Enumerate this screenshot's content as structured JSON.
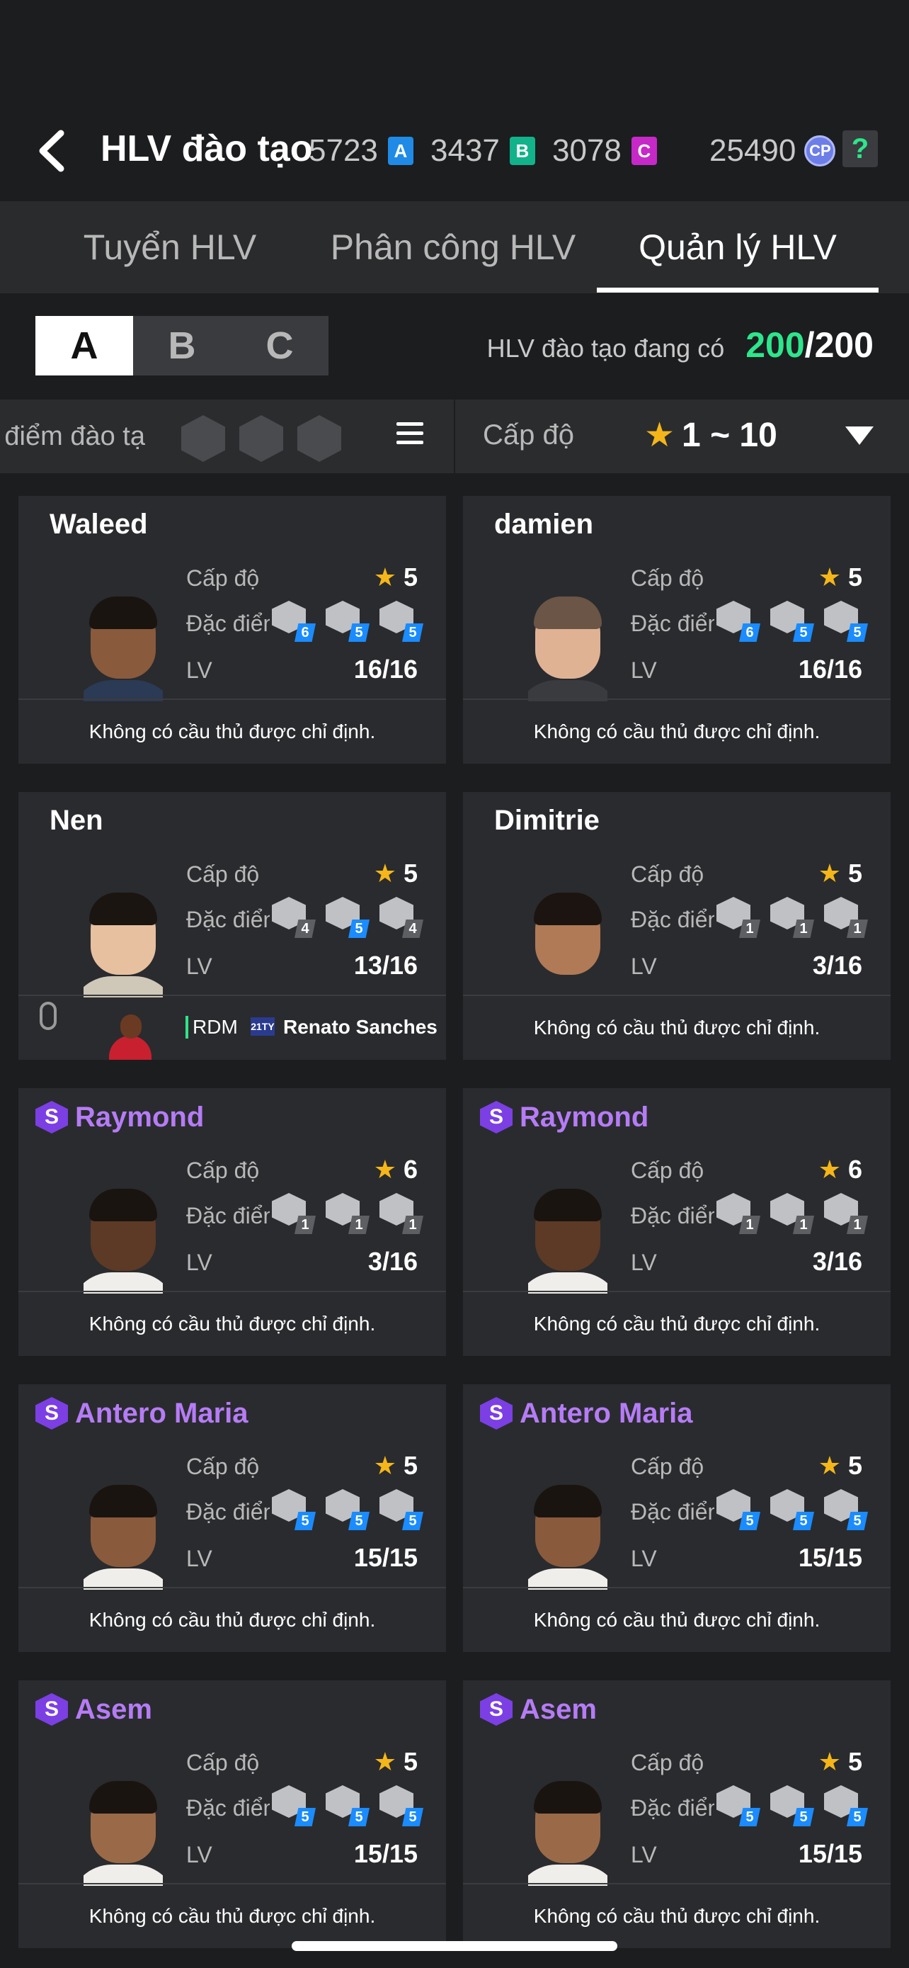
{
  "header": {
    "title": "HLV đào tạo",
    "currencies": [
      {
        "amount": "5723",
        "badge": "A",
        "color": "#1f8be6"
      },
      {
        "amount": "3437",
        "badge": "B",
        "color": "#12b38a"
      },
      {
        "amount": "3078",
        "badge": "C",
        "color": "#c629c8"
      }
    ],
    "cp_amount": "25490",
    "cp_label": "CP",
    "help_label": "?"
  },
  "tabs": [
    {
      "label": "Tuyển HLV",
      "active": false
    },
    {
      "label": "Phân công HLV",
      "active": false
    },
    {
      "label": "Quản lý HLV",
      "active": true
    }
  ],
  "groups": [
    {
      "label": "A",
      "active": true
    },
    {
      "label": "B",
      "active": false
    },
    {
      "label": "C",
      "active": false
    }
  ],
  "capacity": {
    "label": "HLV đào tạo đang có",
    "current": "200",
    "separator": "/",
    "max": "200"
  },
  "filter": {
    "trait_filter_label": "điểm đào tạ",
    "level_label": "Cấp độ",
    "level_range": "1 ~ 10"
  },
  "labels": {
    "level": "Cấp độ",
    "trait": "Đặc điểm",
    "lv": "LV",
    "no_player": "Không có cầu thủ được chỉ định."
  },
  "coaches": [
    {
      "name": "Waleed",
      "special": false,
      "stars": "5",
      "traits": [
        {
          "n": "6",
          "c": "blue"
        },
        {
          "n": "5",
          "c": "blue"
        },
        {
          "n": "5",
          "c": "blue"
        }
      ],
      "lv": "16/16",
      "skin": "#8a5a3c",
      "hair": "#1a1410",
      "shirt": "#2b3a55",
      "assigned": null
    },
    {
      "name": "damien",
      "special": false,
      "stars": "5",
      "traits": [
        {
          "n": "6",
          "c": "blue"
        },
        {
          "n": "5",
          "c": "blue"
        },
        {
          "n": "5",
          "c": "blue"
        }
      ],
      "lv": "16/16",
      "skin": "#e0b294",
      "hair": "#6b5546",
      "shirt": "#3a3b3f",
      "assigned": null
    },
    {
      "name": "Nen",
      "special": false,
      "stars": "5",
      "traits": [
        {
          "n": "4",
          "c": "grey"
        },
        {
          "n": "5",
          "c": "blue"
        },
        {
          "n": "4",
          "c": "grey"
        }
      ],
      "lv": "13/16",
      "skin": "#e7c0a0",
      "hair": "#1b1512",
      "shirt": "#cfc7b8",
      "assigned": {
        "position": "RDM",
        "season": "21TY",
        "player": "Renato Sanches"
      }
    },
    {
      "name": "Dimitrie",
      "special": false,
      "stars": "5",
      "traits": [
        {
          "n": "1",
          "c": "grey"
        },
        {
          "n": "1",
          "c": "grey"
        },
        {
          "n": "1",
          "c": "grey"
        }
      ],
      "lv": "3/16",
      "skin": "#b07a56",
      "hair": "#1b1410",
      "shirt": "#2a2b2e",
      "assigned": null
    },
    {
      "name": "Raymond",
      "special": true,
      "special_badge": "S",
      "stars": "6",
      "traits": [
        {
          "n": "1",
          "c": "grey"
        },
        {
          "n": "1",
          "c": "grey"
        },
        {
          "n": "1",
          "c": "grey"
        }
      ],
      "lv": "3/16",
      "skin": "#5c3a26",
      "hair": "#1a1410",
      "shirt": "#f0eeea",
      "assigned": null
    },
    {
      "name": "Raymond",
      "special": true,
      "special_badge": "S",
      "stars": "6",
      "traits": [
        {
          "n": "1",
          "c": "grey"
        },
        {
          "n": "1",
          "c": "grey"
        },
        {
          "n": "1",
          "c": "grey"
        }
      ],
      "lv": "3/16",
      "skin": "#5c3a26",
      "hair": "#1a1410",
      "shirt": "#f0eeea",
      "assigned": null
    },
    {
      "name": "Antero Maria",
      "special": true,
      "special_badge": "S",
      "stars": "5",
      "traits": [
        {
          "n": "5",
          "c": "blue"
        },
        {
          "n": "5",
          "c": "blue"
        },
        {
          "n": "5",
          "c": "blue"
        }
      ],
      "lv": "15/15",
      "skin": "#8a5a3c",
      "hair": "#1a1410",
      "shirt": "#f0eeea",
      "assigned": null
    },
    {
      "name": "Antero Maria",
      "special": true,
      "special_badge": "S",
      "stars": "5",
      "traits": [
        {
          "n": "5",
          "c": "blue"
        },
        {
          "n": "5",
          "c": "blue"
        },
        {
          "n": "5",
          "c": "blue"
        }
      ],
      "lv": "15/15",
      "skin": "#8a5a3c",
      "hair": "#1a1410",
      "shirt": "#f0eeea",
      "assigned": null
    },
    {
      "name": "Asem",
      "special": true,
      "special_badge": "S",
      "stars": "5",
      "traits": [
        {
          "n": "5",
          "c": "blue"
        },
        {
          "n": "5",
          "c": "blue"
        },
        {
          "n": "5",
          "c": "blue"
        }
      ],
      "lv": "15/15",
      "skin": "#9a6a48",
      "hair": "#1a1410",
      "shirt": "#f0eeea",
      "assigned": null
    },
    {
      "name": "Asem",
      "special": true,
      "special_badge": "S",
      "stars": "5",
      "traits": [
        {
          "n": "5",
          "c": "blue"
        },
        {
          "n": "5",
          "c": "blue"
        },
        {
          "n": "5",
          "c": "blue"
        }
      ],
      "lv": "15/15",
      "skin": "#9a6a48",
      "hair": "#1a1410",
      "shirt": "#f0eeea",
      "assigned": null
    }
  ]
}
